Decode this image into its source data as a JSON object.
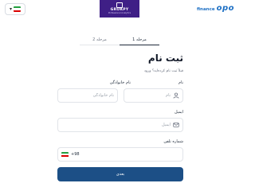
{
  "header": {
    "banner_title": "GROKPY",
    "banner_subtitle": "Professional Analytics",
    "brand_small": "finance",
    "brand_big": "opo",
    "lang_flag": "iran-flag",
    "colors": {
      "banner": "#3f1f86",
      "brand": "#1c6fc4",
      "flag_green": "#239f40",
      "flag_white": "#ffffff",
      "flag_red": "#da0000"
    }
  },
  "steps": {
    "step1": "مرحله 1",
    "step2": "مرحله 2"
  },
  "form": {
    "title": "ثبت نام",
    "subtitle": "قبلاً ثبت نام کرده‌اید؟ ورود",
    "first_name_label": "نام",
    "first_name_placeholder": "نام",
    "last_name_label": "نام خانوادگی",
    "last_name_placeholder": "نام خانوادگی",
    "email_label": "ایمیل",
    "email_placeholder": "ایمیل",
    "phone_label": "شماره تلفن",
    "phone_code": "+98",
    "submit_label": "بعدی",
    "colors": {
      "primary": "#1c4f86"
    }
  }
}
